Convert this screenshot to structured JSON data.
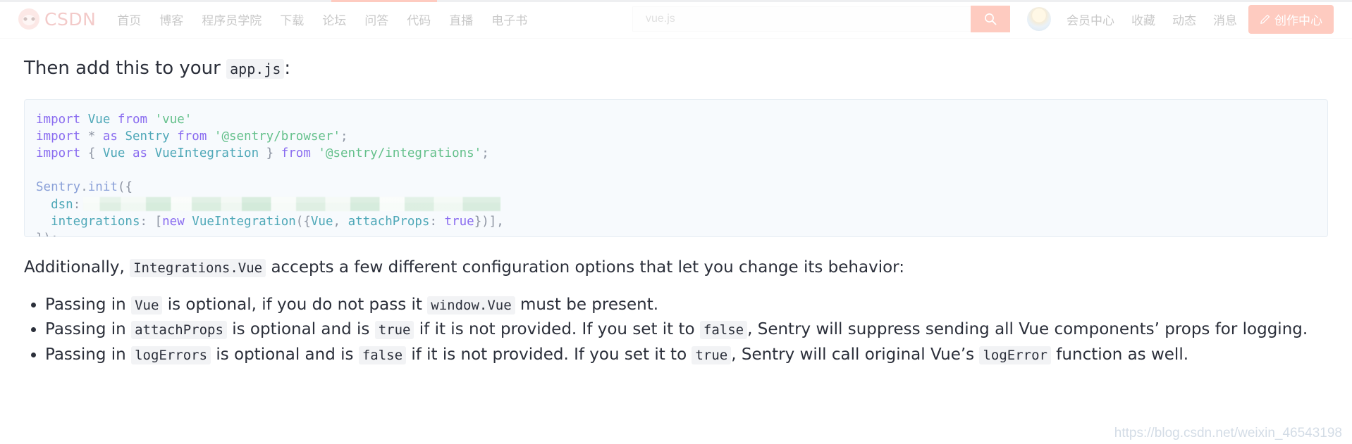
{
  "header": {
    "logo_text": "CSDN",
    "logo_icon": "csdn-monkey-logo",
    "nav_items": [
      {
        "label": "首页"
      },
      {
        "label": "博客"
      },
      {
        "label": "程序员学院"
      },
      {
        "label": "下载"
      },
      {
        "label": "论坛"
      },
      {
        "label": "问答"
      },
      {
        "label": "代码"
      },
      {
        "label": "直播"
      },
      {
        "label": "电子书"
      }
    ],
    "search": {
      "value": "vue.js",
      "placeholder": "vue.js",
      "button_icon": "search-icon"
    },
    "avatar_icon": "user-avatar",
    "right_links": [
      {
        "label": "会员中心"
      },
      {
        "label": "收藏"
      },
      {
        "label": "动态"
      },
      {
        "label": "消息"
      }
    ],
    "create_button": {
      "label": "创作中心",
      "icon": "pencil-icon"
    },
    "accent_color": "#fc5531"
  },
  "article": {
    "lead": {
      "before": "Then add this to your",
      "code": "app.js",
      "after": ":"
    },
    "code_block": {
      "language": "javascript",
      "lines": [
        {
          "tokens": [
            {
              "t": "import ",
              "c": "kw"
            },
            {
              "t": "Vue ",
              "c": "id"
            },
            {
              "t": "from ",
              "c": "kw"
            },
            {
              "t": "'vue'",
              "c": "str"
            }
          ]
        },
        {
          "tokens": [
            {
              "t": "import ",
              "c": "kw"
            },
            {
              "t": "* ",
              "c": "punc"
            },
            {
              "t": "as ",
              "c": "kw"
            },
            {
              "t": "Sentry ",
              "c": "id"
            },
            {
              "t": "from ",
              "c": "kw"
            },
            {
              "t": "'@sentry/browser'",
              "c": "str"
            },
            {
              "t": ";",
              "c": "punc"
            }
          ]
        },
        {
          "tokens": [
            {
              "t": "import ",
              "c": "kw"
            },
            {
              "t": "{ ",
              "c": "punc"
            },
            {
              "t": "Vue ",
              "c": "id"
            },
            {
              "t": "as ",
              "c": "kw"
            },
            {
              "t": "VueIntegration ",
              "c": "id"
            },
            {
              "t": "} ",
              "c": "punc"
            },
            {
              "t": "from ",
              "c": "kw"
            },
            {
              "t": "'@sentry/integrations'",
              "c": "str"
            },
            {
              "t": ";",
              "c": "punc"
            }
          ]
        },
        {
          "tokens": []
        },
        {
          "tokens": [
            {
              "t": "Sentry",
              "c": "fn"
            },
            {
              "t": ".",
              "c": "punc"
            },
            {
              "t": "init",
              "c": "fn"
            },
            {
              "t": "({",
              "c": "punc"
            }
          ]
        },
        {
          "tokens": [
            {
              "t": "  dsn",
              "c": "id"
            },
            {
              "t": ":",
              "c": "punc"
            }
          ],
          "redacted": true
        },
        {
          "tokens": [
            {
              "t": "  integrations",
              "c": "id"
            },
            {
              "t": ": [",
              "c": "punc"
            },
            {
              "t": "new ",
              "c": "kw"
            },
            {
              "t": "VueIntegration",
              "c": "id"
            },
            {
              "t": "({",
              "c": "punc"
            },
            {
              "t": "Vue",
              "c": "id"
            },
            {
              "t": ", ",
              "c": "punc"
            },
            {
              "t": "attachProps",
              "c": "id"
            },
            {
              "t": ": ",
              "c": "punc"
            },
            {
              "t": "true",
              "c": "bool"
            },
            {
              "t": "})],",
              "c": "punc"
            }
          ]
        },
        {
          "tokens": [
            {
              "t": "});",
              "c": "punc"
            }
          ]
        }
      ]
    },
    "paragraph": {
      "before": "Additionally,",
      "code": "Integrations.Vue",
      "after": "accepts a few different configuration options that let you change its behavior:"
    },
    "options_list": [
      {
        "parts": [
          {
            "t": "Passing in ",
            "code": false
          },
          {
            "t": "Vue",
            "code": true
          },
          {
            "t": " is optional, if you do not pass it ",
            "code": false
          },
          {
            "t": "window.Vue",
            "code": true
          },
          {
            "t": " must be present.",
            "code": false
          }
        ]
      },
      {
        "parts": [
          {
            "t": "Passing in ",
            "code": false
          },
          {
            "t": "attachProps",
            "code": true
          },
          {
            "t": " is optional and is ",
            "code": false
          },
          {
            "t": "true",
            "code": true
          },
          {
            "t": " if it is not provided. If you set it to ",
            "code": false
          },
          {
            "t": "false",
            "code": true
          },
          {
            "t": ", Sentry will suppress sending all Vue components’ props for logging.",
            "code": false
          }
        ]
      },
      {
        "parts": [
          {
            "t": "Passing in ",
            "code": false
          },
          {
            "t": "logErrors",
            "code": true
          },
          {
            "t": " is optional and is ",
            "code": false
          },
          {
            "t": "false",
            "code": true
          },
          {
            "t": " if it is not provided. If you set it to ",
            "code": false
          },
          {
            "t": "true",
            "code": true
          },
          {
            "t": ", Sentry will call original Vue’s ",
            "code": false
          },
          {
            "t": "logError",
            "code": true
          },
          {
            "t": " function as well.",
            "code": false
          }
        ]
      }
    ],
    "watermark": "https://blog.csdn.net/weixin_46543198"
  }
}
